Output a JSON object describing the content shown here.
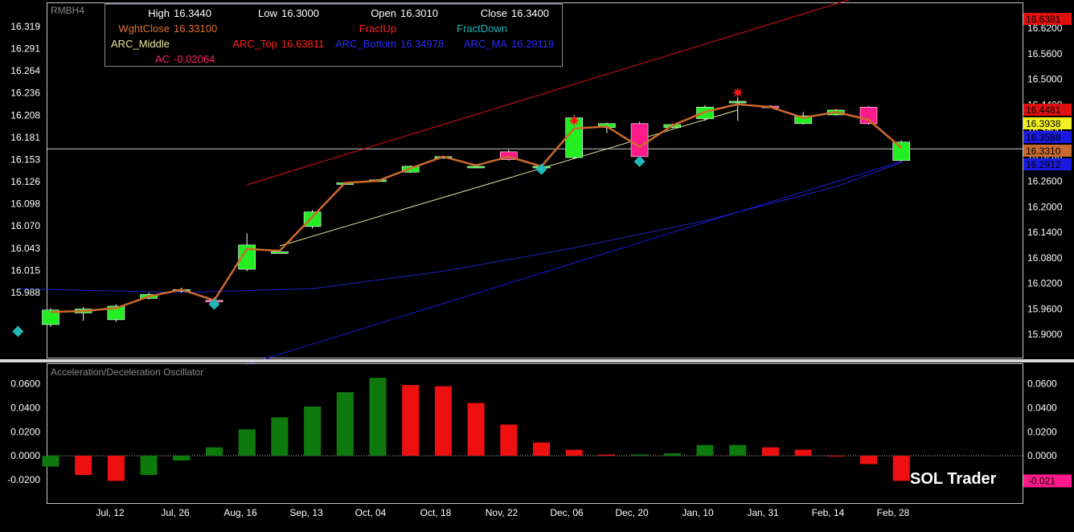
{
  "symbol": "RMBH4",
  "branding": "SOL Trader",
  "colors": {
    "background": "#000000",
    "up_candle": "#22ee22",
    "down_candle": "#ff1a8c",
    "wght_close": "#cc6a2a",
    "arc_top": "#e01010",
    "arc_bottom": "#1a1ae0",
    "arc_middle": "#e6e6a0",
    "arc_ma": "#2020c0",
    "fract_up": "#ff1010",
    "fract_down": "#20b8b8",
    "ac_up": "#0e7a0e",
    "ac_down": "#ee1010"
  },
  "info_box": {
    "rows": [
      [
        {
          "label": "High",
          "value": "16.3440",
          "color": "#ffffff"
        },
        {
          "label": "Low",
          "value": "16.3000",
          "color": "#ffffff"
        },
        {
          "label": "Open",
          "value": "16.3010",
          "color": "#ffffff"
        },
        {
          "label": "Close",
          "value": "16.3400",
          "color": "#ffffff"
        }
      ],
      [
        {
          "label": "WghtClose",
          "value": "16.33100",
          "color": "#e07030"
        },
        {
          "label": "",
          "value": "",
          "color": "#ffffff"
        },
        {
          "label": "FractUp",
          "value": "",
          "color": "#ff2020"
        },
        {
          "label": "FractDown",
          "value": "",
          "color": "#20b8b8"
        }
      ],
      [
        {
          "label": "ARC_Middle",
          "value": "",
          "color": "#e6e6a0"
        },
        {
          "label": "ARC_Top",
          "value": "16.63811",
          "color": "#ff2020"
        },
        {
          "label": "ARC_Bottom",
          "value": "16.34978",
          "color": "#2a2aff"
        },
        {
          "label": "ARC_MA",
          "value": "16.29119",
          "color": "#2a2aff"
        }
      ],
      [
        {
          "label": "AC",
          "value": "-0.02064",
          "color": "#ff2060"
        },
        {
          "label": "",
          "value": "",
          "color": "#ffffff"
        },
        {
          "label": "",
          "value": "",
          "color": "#ffffff"
        },
        {
          "label": "",
          "value": "",
          "color": "#ffffff"
        }
      ]
    ]
  },
  "chart_data": [
    {
      "type": "candlestick",
      "title": "RMBH4",
      "left_axis_ticks": [
        "16.319",
        "16.291",
        "16.264",
        "16.236",
        "16.208",
        "16.181",
        "16.153",
        "16.126",
        "16.098",
        "16.070",
        "16.043",
        "16.015",
        "15.988"
      ],
      "right_axis_ticks": [
        "16.6200",
        "16.5600",
        "16.5000",
        "16.4400",
        "16.3800",
        "16.3200",
        "16.2600",
        "16.2000",
        "16.1400",
        "16.0800",
        "16.0200",
        "15.9600",
        "15.9000"
      ],
      "right_axis_value_boxes": [
        {
          "text": "16.6381",
          "bg": "#e01010"
        },
        {
          "text": "16.4481",
          "bg": "#e01010"
        },
        {
          "text": "16.3938",
          "bg": "#f0f020"
        },
        {
          "text": "16.3588",
          "bg": "#1a1ae0"
        },
        {
          "text": "16.3310",
          "bg": "#c86a30"
        },
        {
          "text": "16.2912",
          "bg": "#1a1ae0"
        }
      ],
      "x_tick_labels": [
        "Jul, 12",
        "Jul, 26",
        "Aug, 16",
        "Sep, 13",
        "Oct, 04",
        "Oct, 18",
        "Nov, 22",
        "Dec, 06",
        "Dec, 20",
        "Jan, 10",
        "Jan, 31",
        "Feb, 14",
        "Feb, 28"
      ],
      "candles": [
        {
          "o": 16.003,
          "c": 16.018,
          "h": 16.02,
          "l": 16.001
        },
        {
          "o": 16.015,
          "c": 16.019,
          "h": 16.021,
          "l": 16.007
        },
        {
          "o": 16.008,
          "c": 16.022,
          "h": 16.024,
          "l": 16.006
        },
        {
          "o": 16.03,
          "c": 16.034,
          "h": 16.036,
          "l": 16.029
        },
        {
          "o": 16.038,
          "c": 16.039,
          "h": 16.041,
          "l": 16.036
        },
        {
          "o": 16.028,
          "c": 16.027,
          "h": 16.031,
          "l": 16.025
        },
        {
          "o": 16.06,
          "c": 16.085,
          "h": 16.097,
          "l": 16.058
        },
        {
          "o": 16.078,
          "c": 16.078,
          "h": 16.08,
          "l": 16.076
        },
        {
          "o": 16.104,
          "c": 16.119,
          "h": 16.121,
          "l": 16.102
        },
        {
          "o": 16.149,
          "c": 16.149,
          "h": 16.15,
          "l": 16.148
        },
        {
          "o": 16.152,
          "c": 16.152,
          "h": 16.153,
          "l": 16.15
        },
        {
          "o": 16.16,
          "c": 16.166,
          "h": 16.167,
          "l": 16.159
        },
        {
          "o": 16.176,
          "c": 16.176,
          "h": 16.177,
          "l": 16.174
        },
        {
          "o": 16.166,
          "c": 16.166,
          "h": 16.167,
          "l": 16.165
        },
        {
          "o": 16.181,
          "c": 16.173,
          "h": 16.183,
          "l": 16.172
        },
        {
          "o": 16.165,
          "c": 16.166,
          "h": 16.167,
          "l": 16.163
        },
        {
          "o": 16.175,
          "c": 16.216,
          "h": 16.219,
          "l": 16.174
        },
        {
          "o": 16.206,
          "c": 16.21,
          "h": 16.211,
          "l": 16.2
        },
        {
          "o": 16.21,
          "c": 16.176,
          "h": 16.212,
          "l": 16.174
        },
        {
          "o": 16.206,
          "c": 16.209,
          "h": 16.21,
          "l": 16.205
        },
        {
          "o": 16.215,
          "c": 16.227,
          "h": 16.229,
          "l": 16.213
        },
        {
          "o": 16.232,
          "c": 16.233,
          "h": 16.24,
          "l": 16.213
        },
        {
          "o": 16.228,
          "c": 16.227,
          "h": 16.229,
          "l": 16.226
        },
        {
          "o": 16.21,
          "c": 16.218,
          "h": 16.222,
          "l": 16.209
        },
        {
          "o": 16.219,
          "c": 16.224,
          "h": 16.225,
          "l": 16.218
        },
        {
          "o": 16.227,
          "c": 16.21,
          "h": 16.228,
          "l": 16.209
        },
        {
          "o": 16.172,
          "c": 16.191,
          "h": 16.193,
          "l": 16.171
        }
      ],
      "wght_close": [
        16.016,
        16.017,
        16.02,
        16.032,
        16.039,
        16.028,
        16.081,
        16.079,
        16.114,
        16.149,
        16.151,
        16.164,
        16.176,
        16.167,
        16.176,
        16.166,
        16.205,
        16.207,
        16.186,
        16.208,
        16.222,
        16.23,
        16.227,
        16.216,
        16.222,
        16.214,
        16.185
      ],
      "arc_top": [
        [
          6,
          16.147
        ],
        [
          26,
          16.354
        ]
      ],
      "arc_bottom": [
        [
          6,
          15.962
        ],
        [
          26,
          16.171
        ]
      ],
      "arc_middle": [
        [
          7,
          16.084
        ],
        [
          21,
          16.224
        ]
      ],
      "arc_ma": [
        [
          -1,
          16.04
        ],
        [
          4,
          16.036
        ],
        [
          8,
          16.04
        ],
        [
          12,
          16.058
        ],
        [
          16,
          16.082
        ],
        [
          20,
          16.11
        ],
        [
          24,
          16.145
        ],
        [
          26,
          16.17
        ]
      ],
      "fract_up": [
        [
          16,
          16.213
        ],
        [
          21,
          16.242
        ]
      ],
      "fract_down": [
        [
          -1,
          15.996
        ],
        [
          5,
          16.024
        ],
        [
          15,
          16.163
        ],
        [
          18,
          16.171
        ]
      ],
      "horizontal_line": 16.184,
      "xlim": [
        -1.5,
        29.5
      ],
      "ylim": [
        15.969,
        16.334
      ]
    },
    {
      "type": "bar",
      "title": "Acceleration/Deceleration Oscillator",
      "left_axis_ticks": [
        "0.0600",
        "0.0400",
        "0.0200",
        "0.0000",
        "-0.0200"
      ],
      "right_axis_ticks": [
        "0.0600",
        "0.0400",
        "0.0200",
        "0.0000",
        "-0.0200"
      ],
      "right_value_box": {
        "text": "-0.021",
        "bg": "#ff1a8c"
      },
      "values": [
        -0.009,
        -0.016,
        -0.021,
        -0.016,
        -0.004,
        0.007,
        0.022,
        0.032,
        0.041,
        0.053,
        0.065,
        0.059,
        0.058,
        0.044,
        0.026,
        0.011,
        0.005,
        0.001,
        0.001,
        0.002,
        0.009,
        0.009,
        0.007,
        0.005,
        0.0,
        -0.007,
        -0.021
      ],
      "ylim": [
        -0.0395,
        0.0765
      ]
    }
  ]
}
